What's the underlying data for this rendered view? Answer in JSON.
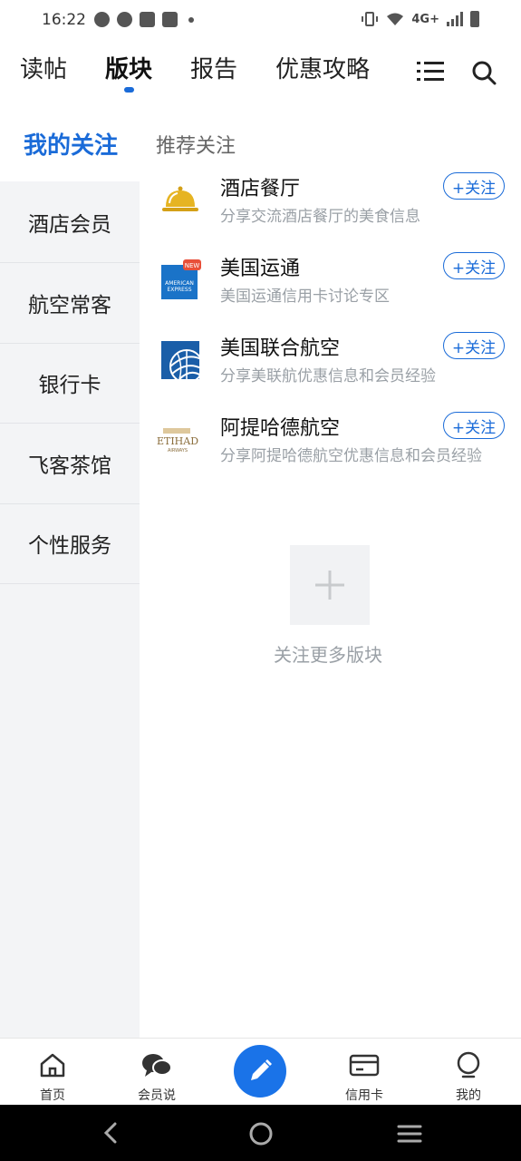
{
  "status_bar": {
    "time": "16:22",
    "network": "4G+"
  },
  "tabs": [
    {
      "label": "读帖",
      "active": false
    },
    {
      "label": "版块",
      "active": true
    },
    {
      "label": "报告",
      "active": false
    },
    {
      "label": "优惠攻略",
      "active": false
    }
  ],
  "sidebar": {
    "header": "我的关注",
    "items": [
      "酒店会员",
      "航空常客",
      "银行卡",
      "飞客茶馆",
      "个性服务"
    ]
  },
  "main": {
    "section_title": "推荐关注",
    "follow_label": "+关注",
    "forums": [
      {
        "name": "酒店餐厅",
        "desc": "分享交流酒店餐厅的美食信息",
        "logo": "cloche-icon"
      },
      {
        "name": "美国运通",
        "desc": "美国运通信用卡讨论专区",
        "logo": "amex-logo",
        "badge": "NEW",
        "logo_text": "AMERICAN EXPRESS"
      },
      {
        "name": "美国联合航空",
        "desc": "分享美联航优惠信息和会员经验",
        "logo": "united-globe-logo"
      },
      {
        "name": "阿提哈德航空",
        "desc": "分享阿提哈德航空优惠信息和会员经验",
        "logo": "etihad-logo",
        "logo_text": "ETIHAD",
        "logo_sub": "AIRWAYS"
      }
    ],
    "add_more_label": "关注更多版块"
  },
  "bottom_nav": [
    {
      "label": "首页",
      "icon": "home-icon"
    },
    {
      "label": "会员说",
      "icon": "chat-icon"
    },
    {
      "label": "",
      "icon": "compose-icon"
    },
    {
      "label": "信用卡",
      "icon": "credit-card-icon"
    },
    {
      "label": "我的",
      "icon": "profile-icon"
    }
  ],
  "colors": {
    "accent": "#1a6bd8",
    "sidebar_bg": "#f3f4f6",
    "muted": "#9aa0a6"
  }
}
